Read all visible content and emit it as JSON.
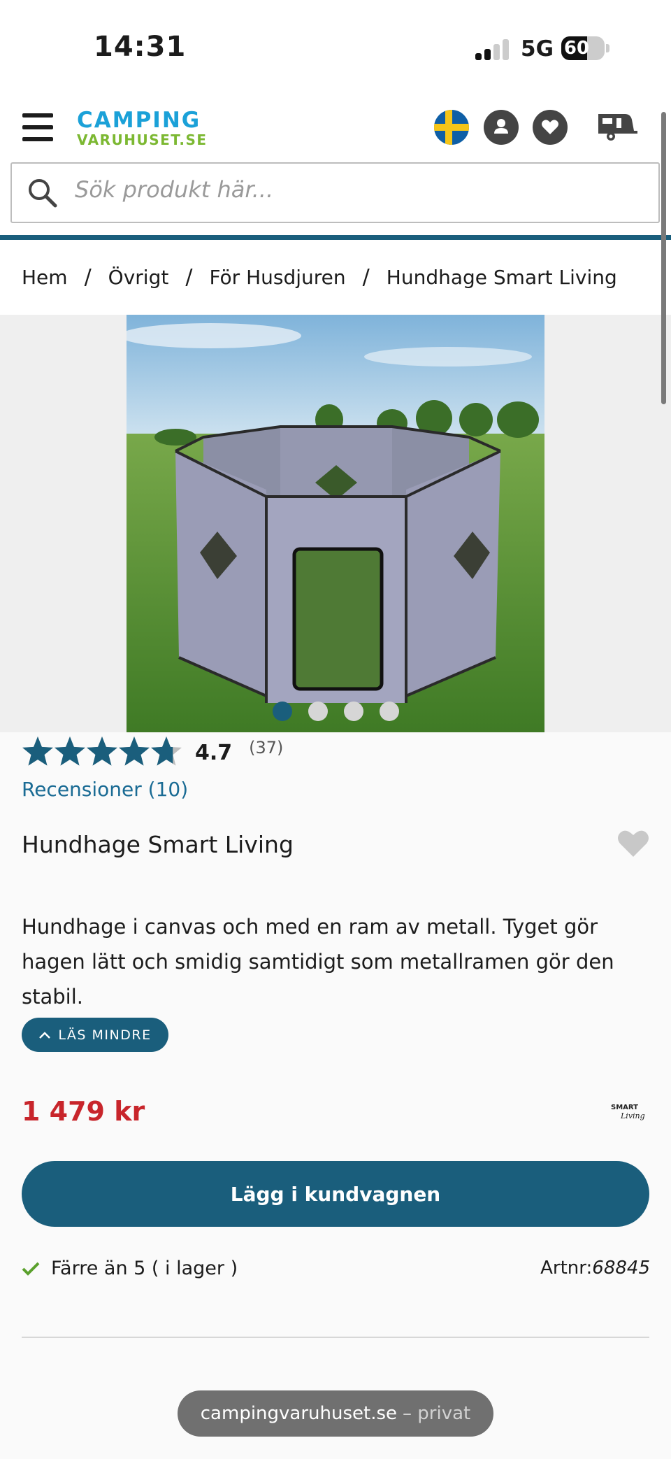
{
  "status_bar": {
    "time": "14:31",
    "network": "5G",
    "battery": "60",
    "battery_level": 0.6
  },
  "header": {
    "logo_line1": "CAMPING",
    "logo_line2": "VARUHUSET.SE",
    "search_placeholder": "Sök produkt här..."
  },
  "breadcrumb": [
    "Hem",
    "Övrigt",
    "För Husdjuren",
    "Hundhage Smart Living"
  ],
  "gallery": {
    "image_count": 4,
    "active_index": 0
  },
  "product": {
    "rating": "4.7",
    "rating_value": 4.7,
    "rating_count": "(37)",
    "reviews_link": "Recensioner (10)",
    "title": "Hundhage Smart Living",
    "description": "Hundhage i canvas och med en ram av metall. Tyget gör hagen lätt och smidig samtidigt som metallramen gör den stabil.",
    "less_button": "LÄS MINDRE",
    "price": "1 479 kr",
    "brand_logo": "SMART Living",
    "add_to_cart": "Lägg i kundvagnen",
    "stock": "Färre än 5 ( i lager )",
    "artnr_label": "Artnr:",
    "artnr_value": "68845"
  },
  "browser": {
    "domain": "campingvaruhuset.se",
    "mode": "– privat"
  },
  "colors": {
    "brand_blue": "#1a5e7c",
    "price_red": "#c8252b",
    "logo_blue": "#1ba1d8",
    "logo_green": "#7cb832"
  },
  "icons": [
    "hamburger-icon",
    "swedish-flag-icon",
    "user-icon",
    "heart-icon",
    "caravan-cart-icon",
    "search-icon",
    "star-icon",
    "chevron-up-icon",
    "check-icon"
  ]
}
